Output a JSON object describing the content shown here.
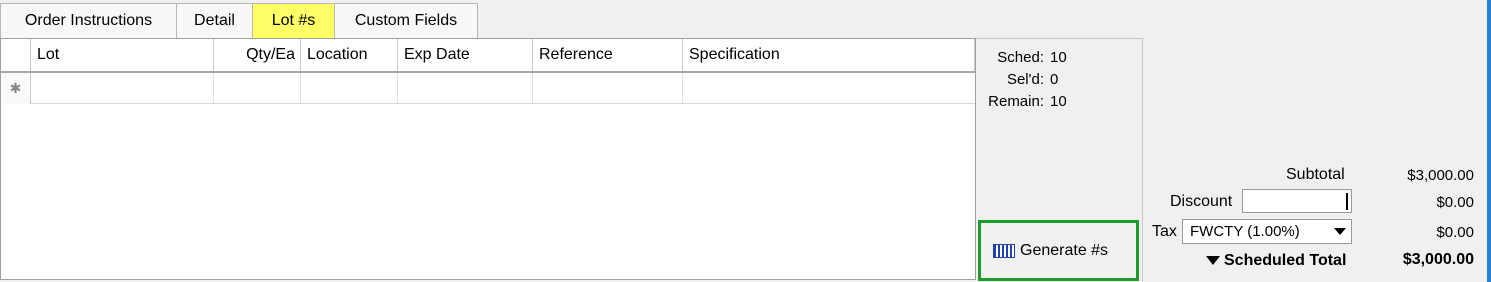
{
  "tabs": [
    {
      "label": "Order Instructions"
    },
    {
      "label": "Detail"
    },
    {
      "label": "Lot #s"
    },
    {
      "label": "Custom Fields"
    }
  ],
  "active_tab": "Lot #s",
  "grid": {
    "columns": [
      "Lot",
      "Qty/Ea",
      "Location",
      "Exp Date",
      "Reference",
      "Specification"
    ],
    "new_row_marker": "✱"
  },
  "sched": {
    "sched_label": "Sched:",
    "sched_value": "10",
    "seld_label": "Sel'd:",
    "seld_value": "0",
    "remain_label": "Remain:",
    "remain_value": "10"
  },
  "generate_button": {
    "label": "Generate #s",
    "icon": "barcode-icon"
  },
  "totals": {
    "subtotal_label": "Subtotal",
    "subtotal_value": "$3,000.00",
    "discount_label": "Discount",
    "discount_input": "",
    "discount_value": "$0.00",
    "tax_label": "Tax",
    "tax_selected": "FWCTY (1.00%)",
    "tax_value": "$0.00",
    "scheduled_total_label": "Scheduled Total",
    "scheduled_total_value": "$3,000.00"
  },
  "colors": {
    "active_tab": "#ffff66",
    "highlight_border": "#1e9a2e"
  }
}
